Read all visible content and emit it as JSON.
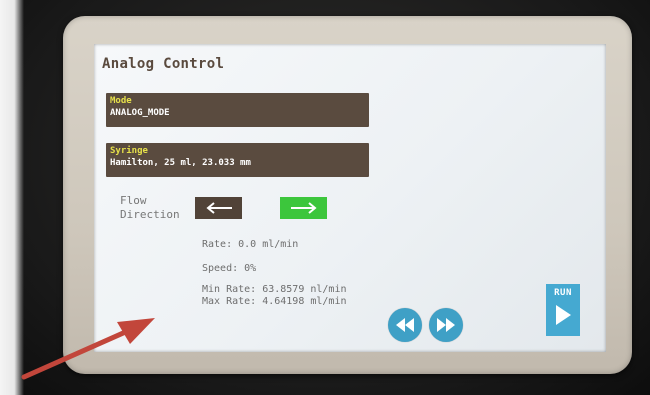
{
  "screen": {
    "title": "Analog Control",
    "mode": {
      "label": "Mode",
      "value": "ANALOG_MODE"
    },
    "syringe": {
      "label": "Syringe",
      "value": "Hamilton, 25 ml, 23.033 mm"
    },
    "flow_direction": {
      "label_line1": "Flow",
      "label_line2": "Direction",
      "left_icon": "arrow-left-icon",
      "right_icon": "arrow-right-icon",
      "selected": "right"
    },
    "rate": "Rate:  0.0 ml/min",
    "speed": "Speed: 0%",
    "min_rate": "Min Rate:  63.8579 nl/min",
    "max_rate": "Max Rate: 4.64198 ml/min",
    "rewind_icon": "rewind-icon",
    "fast_forward_icon": "fast-forward-icon",
    "run_label": "RUN",
    "run_icon": "play-icon"
  },
  "colors": {
    "field_bg": "#5a4b3f",
    "field_label": "#e6e04a",
    "selected_direction": "#3cc63c",
    "unselected_direction": "#514338",
    "accent_blue": "#3fa0c6",
    "annotation_arrow": "#c2463b"
  },
  "annotation": {
    "icon": "pointer-arrow-icon"
  }
}
